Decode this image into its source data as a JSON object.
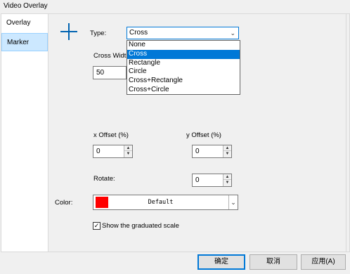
{
  "window": {
    "title": "Video Overlay"
  },
  "sidebar": {
    "items": [
      {
        "label": "Overlay"
      },
      {
        "label": "Marker"
      }
    ]
  },
  "marker": {
    "icon": "cross-marker-icon",
    "type_label": "Type:",
    "type_value": "Cross",
    "type_options": [
      "None",
      "Cross",
      "Rectangle",
      "Circle",
      "Cross+Rectangle",
      "Cross+Circle"
    ],
    "cross_width_label": "Cross Widt",
    "cross_width_value": "50",
    "x_offset_label": "x Offset (%)",
    "x_offset_value": "0",
    "y_offset_label": "y Offset (%)",
    "y_offset_value": "0",
    "rotate_label": "Rotate:",
    "rotate_value": "0",
    "color_label": "Color:",
    "color_value": "Default",
    "color_swatch": "#ff0000",
    "graduated_scale_label": "Show the graduated scale",
    "graduated_scale_checked": true
  },
  "buttons": {
    "ok": "确定",
    "cancel": "取消",
    "apply": "应用(A)"
  }
}
